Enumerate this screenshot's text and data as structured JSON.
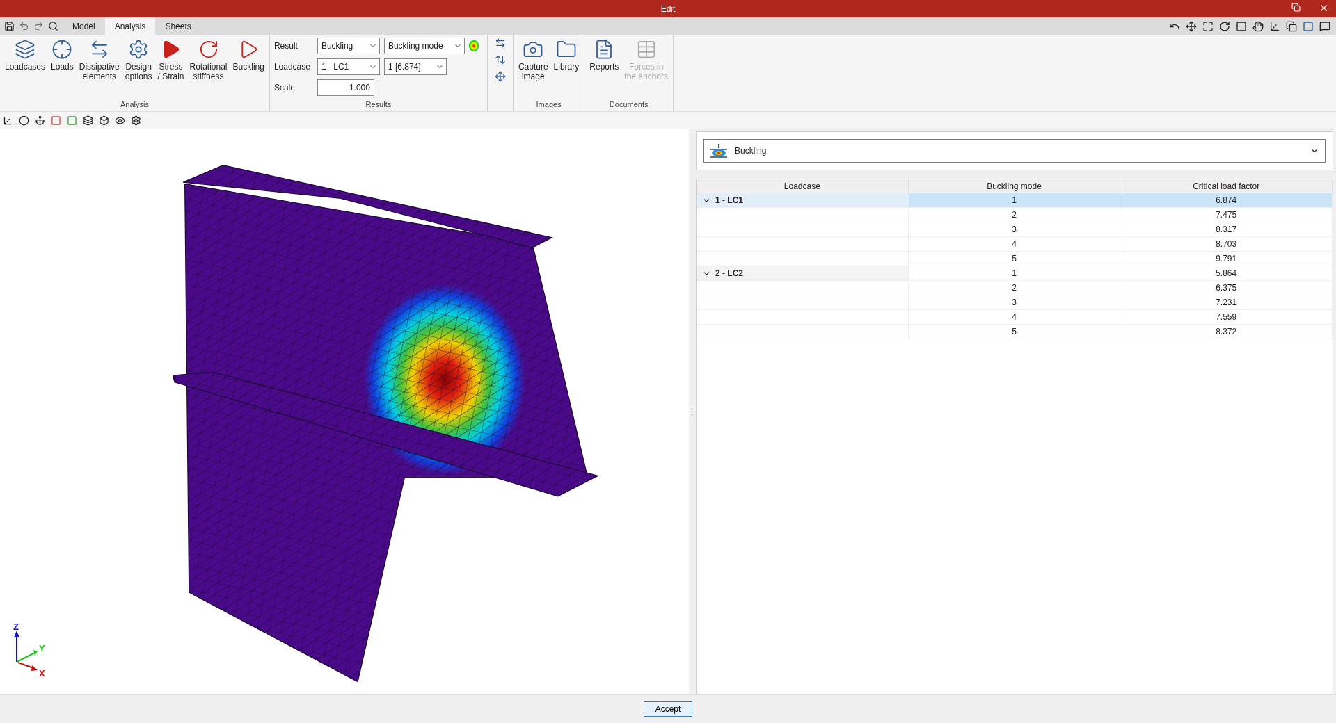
{
  "window": {
    "title": "Edit"
  },
  "tabs": [
    {
      "label": "Model",
      "selected": false
    },
    {
      "label": "Analysis",
      "selected": true
    },
    {
      "label": "Sheets",
      "selected": false
    }
  ],
  "ribbon": {
    "analysis": {
      "title": "Analysis",
      "buttons": [
        {
          "kind": "loadcases",
          "label": "Loadcases",
          "disabled": false
        },
        {
          "kind": "loads",
          "label": "Loads",
          "disabled": false
        },
        {
          "kind": "dissipative",
          "label": "Dissipative\nelements",
          "disabled": false
        },
        {
          "kind": "design",
          "label": "Design\noptions",
          "disabled": false
        },
        {
          "kind": "stress",
          "label": "Stress\n/ Strain",
          "disabled": false
        },
        {
          "kind": "rotational",
          "label": "Rotational\nstiffness",
          "disabled": false
        },
        {
          "kind": "buckling",
          "label": "Buckling",
          "disabled": false
        }
      ]
    },
    "results": {
      "title": "Results",
      "result_label": "Result",
      "result": "Buckling",
      "result_type": "Buckling mode",
      "loadcase_label": "Loadcase",
      "loadcase": "1 - LC1",
      "mode": "1 [6.874]",
      "scale_label": "Scale",
      "scale": "1.000"
    },
    "images": {
      "title": "Images",
      "buttons": [
        {
          "kind": "capture",
          "label": "Capture\nimage",
          "disabled": false
        },
        {
          "kind": "library",
          "label": "Library",
          "disabled": false
        }
      ]
    },
    "documents": {
      "title": "Documents",
      "buttons": [
        {
          "kind": "reports",
          "label": "Reports",
          "disabled": false
        },
        {
          "kind": "anchors",
          "label": "Forces in\nthe anchors",
          "disabled": true
        }
      ]
    }
  },
  "axes": {
    "z": "Z",
    "y": "Y",
    "x": "X"
  },
  "selector": {
    "label": "Buckling"
  },
  "table": {
    "columns": [
      "Loadcase",
      "Buckling mode",
      "Critical load factor"
    ],
    "groups": [
      {
        "label": "1 - LC1",
        "expanded": true,
        "rows": [
          {
            "mode": "1",
            "factor": "6.874",
            "selected": true
          },
          {
            "mode": "2",
            "factor": "7.475",
            "selected": false
          },
          {
            "mode": "3",
            "factor": "8.317",
            "selected": false
          },
          {
            "mode": "4",
            "factor": "8.703",
            "selected": false
          },
          {
            "mode": "5",
            "factor": "9.791",
            "selected": false
          }
        ]
      },
      {
        "label": "2 - LC2",
        "expanded": true,
        "rows": [
          {
            "mode": "1",
            "factor": "5.864",
            "selected": false
          },
          {
            "mode": "2",
            "factor": "6.375",
            "selected": false
          },
          {
            "mode": "3",
            "factor": "7.231",
            "selected": false
          },
          {
            "mode": "4",
            "factor": "7.559",
            "selected": false
          },
          {
            "mode": "5",
            "factor": "8.372",
            "selected": false
          }
        ]
      }
    ]
  },
  "footer": {
    "accept": "Accept"
  }
}
